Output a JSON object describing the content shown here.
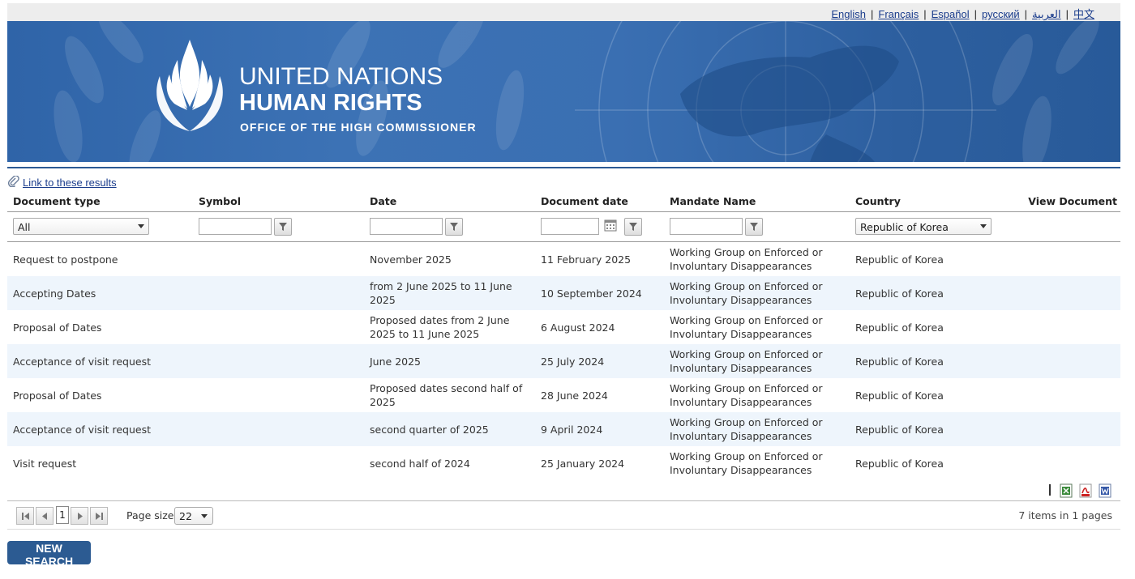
{
  "languages": [
    "English",
    "Français",
    "Español",
    "русский",
    "العربية",
    "中文"
  ],
  "banner": {
    "line1": "UNITED NATIONS",
    "line2": "HUMAN RIGHTS",
    "line3": "OFFICE OF THE HIGH COMMISSIONER"
  },
  "link_results": "Link to these results",
  "columns": {
    "document_type": "Document type",
    "symbol": "Symbol",
    "date": "Date",
    "document_date": "Document date",
    "mandate_name": "Mandate Name",
    "country": "Country",
    "view_document": "View Document"
  },
  "filters": {
    "document_type": "All",
    "country": "Republic of Korea"
  },
  "rows": [
    {
      "type": "Request to postpone",
      "date": "November 2025",
      "doc_date": "11 February 2025",
      "mandate": "Working Group on Enforced or Involuntary Disappearances",
      "country": "Republic of Korea"
    },
    {
      "type": "Accepting Dates",
      "date": "from 2 June 2025 to 11 June 2025",
      "doc_date": "10 September 2024",
      "mandate": "Working Group on Enforced or Involuntary Disappearances",
      "country": "Republic of Korea"
    },
    {
      "type": "Proposal of Dates",
      "date": "Proposed dates from 2 June 2025 to 11 June 2025",
      "doc_date": "6 August 2024",
      "mandate": "Working Group on Enforced or Involuntary Disappearances",
      "country": "Republic of Korea"
    },
    {
      "type": "Acceptance of visit request",
      "date": "June 2025",
      "doc_date": "25 July 2024",
      "mandate": "Working Group on Enforced or Involuntary Disappearances",
      "country": "Republic of Korea"
    },
    {
      "type": "Proposal of Dates",
      "date": "Proposed dates second half of 2025",
      "doc_date": "28 June 2024",
      "mandate": "Working Group on Enforced or Involuntary Disappearances",
      "country": "Republic of Korea"
    },
    {
      "type": "Acceptance of visit request",
      "date": "second quarter of 2025",
      "doc_date": "9 April 2024",
      "mandate": "Working Group on Enforced or Involuntary Disappearances",
      "country": "Republic of Korea"
    },
    {
      "type": "Visit request",
      "date": "second half of 2024",
      "doc_date": "25 January 2024",
      "mandate": "Working Group on Enforced or Involuntary Disappearances",
      "country": "Republic of Korea"
    }
  ],
  "pager": {
    "current_page": "1",
    "page_size_label": "Page size:",
    "page_size": "22",
    "info": "7 items in 1 pages"
  },
  "new_search_label": "NEW SEARCH",
  "colors": {
    "accent": "#2c5b92",
    "row_alt": "#eef5fc",
    "link": "#1a3c8c"
  }
}
